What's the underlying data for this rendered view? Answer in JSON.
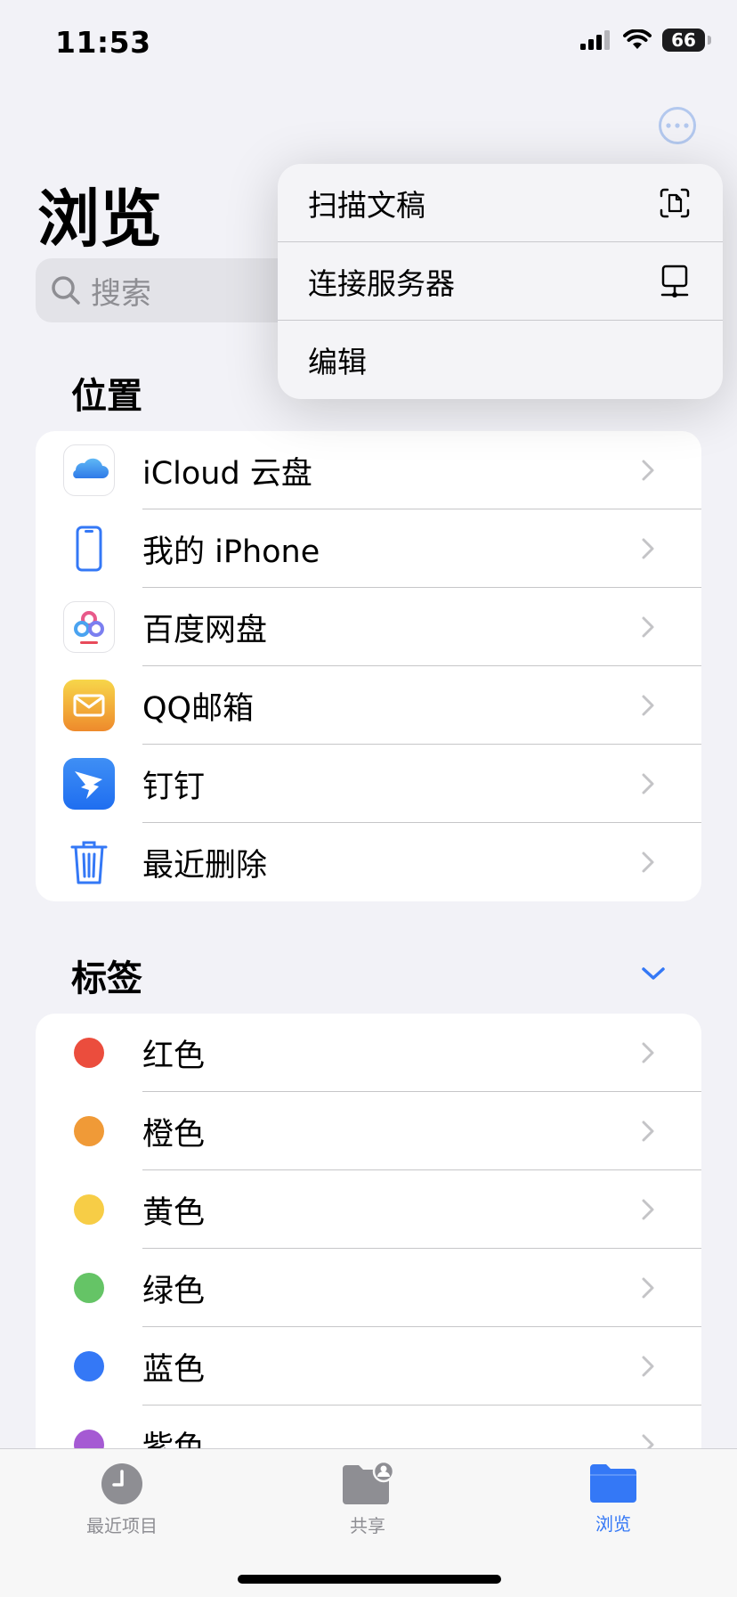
{
  "status_bar": {
    "time": "11:53",
    "battery": "66"
  },
  "page": {
    "title": "浏览",
    "search_placeholder": "搜索"
  },
  "locations": {
    "title": "位置",
    "items": [
      {
        "label": "iCloud 云盘",
        "icon": "icloud-icon"
      },
      {
        "label": "我的 iPhone",
        "icon": "iphone-icon"
      },
      {
        "label": "百度网盘",
        "icon": "baidu-netdisk-icon"
      },
      {
        "label": "QQ邮箱",
        "icon": "qq-mail-icon"
      },
      {
        "label": "钉钉",
        "icon": "dingtalk-icon"
      },
      {
        "label": "最近删除",
        "icon": "trash-icon"
      }
    ]
  },
  "tags": {
    "title": "标签",
    "items": [
      {
        "label": "红色",
        "color": "#eb4d3d"
      },
      {
        "label": "橙色",
        "color": "#f09a37"
      },
      {
        "label": "黄色",
        "color": "#f7cd46"
      },
      {
        "label": "绿色",
        "color": "#65c466"
      },
      {
        "label": "蓝色",
        "color": "#3478f6"
      },
      {
        "label": "紫色",
        "color": "#a55ad3"
      }
    ]
  },
  "menu": {
    "items": [
      {
        "label": "扫描文稿",
        "icon": "scan-document-icon"
      },
      {
        "label": "连接服务器",
        "icon": "server-icon"
      },
      {
        "label": "编辑"
      }
    ]
  },
  "tab_bar": {
    "tabs": [
      {
        "label": "最近项目",
        "icon": "clock-icon",
        "active": false
      },
      {
        "label": "共享",
        "icon": "shared-folder-icon",
        "active": false
      },
      {
        "label": "浏览",
        "icon": "folder-icon",
        "active": true
      }
    ]
  },
  "colors": {
    "accent": "#3478f6",
    "inactive": "#8e8e93"
  }
}
